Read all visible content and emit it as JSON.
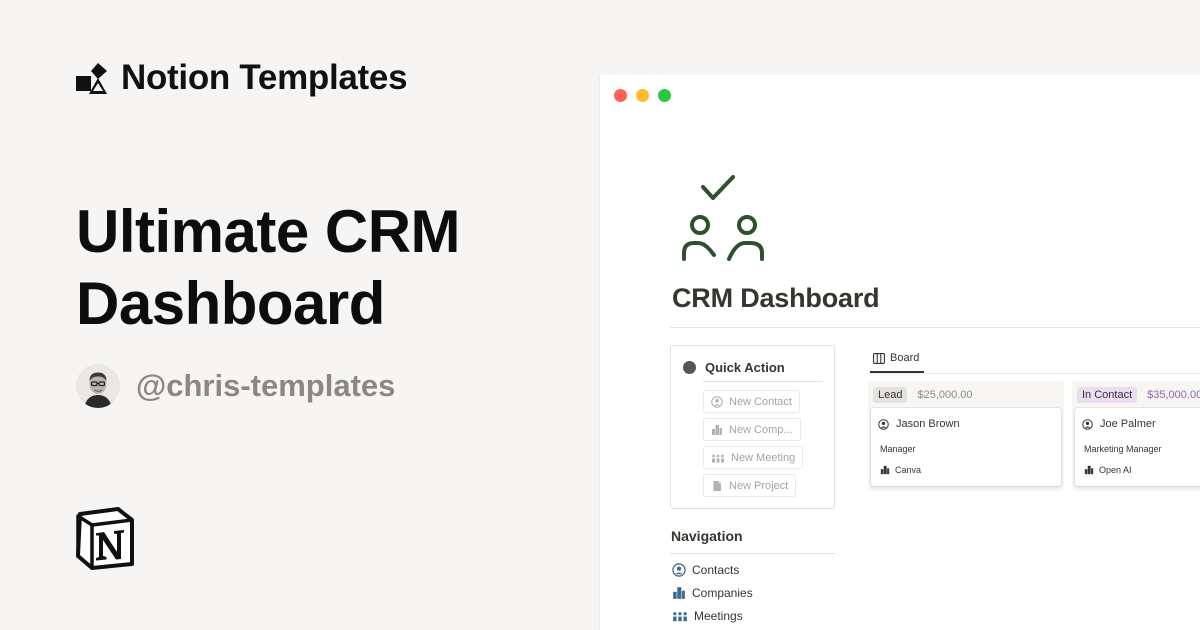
{
  "brand": {
    "name": "Notion Templates"
  },
  "headline": {
    "line1": "Ultimate CRM",
    "line2": "Dashboard"
  },
  "author": {
    "handle": "@chris-templates"
  },
  "colors": {
    "accent_green": "#2f4f2f",
    "tag_lead": "#e3e2e0",
    "tag_contact": "#e8deee"
  },
  "window": {
    "page_title": "CRM Dashboard",
    "quick_action": {
      "title": "Quick Action",
      "buttons": [
        {
          "label": "New Contact",
          "icon": "user-circle-icon"
        },
        {
          "label": "New Comp...",
          "icon": "building-icon"
        },
        {
          "label": "New Meeting",
          "icon": "people-icon"
        },
        {
          "label": "New Project",
          "icon": "document-icon"
        }
      ]
    },
    "navigation": {
      "title": "Navigation",
      "items": [
        {
          "label": "Contacts",
          "icon": "user-circle-icon"
        },
        {
          "label": "Companies",
          "icon": "building-icon"
        },
        {
          "label": "Meetings",
          "icon": "people-icon"
        }
      ]
    },
    "board": {
      "tab_label": "Board",
      "columns": [
        {
          "status": "Lead",
          "amount": "$25,000.00",
          "card": {
            "name": "Jason Brown",
            "role": "Manager",
            "company": "Canva"
          }
        },
        {
          "status": "In Contact",
          "amount": "$35,000.00",
          "card": {
            "name": "Joe Palmer",
            "role": "Marketing Manager",
            "company": "Open AI"
          }
        }
      ]
    }
  }
}
